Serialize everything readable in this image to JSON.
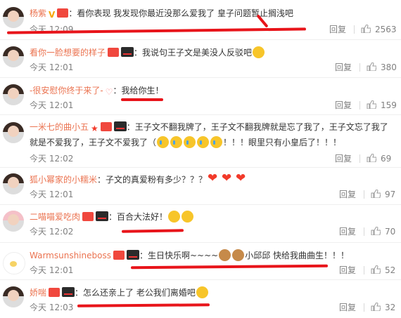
{
  "actions": {
    "reply": "回复"
  },
  "colors": {
    "name": "#eb7350",
    "meta": "#808080",
    "underline": "#e8141a"
  },
  "comments": [
    {
      "name": "杨紫",
      "text": "：看你表现 我发现你最近没那么爱我了 皇子问题暂止搁浅吧",
      "time": "今天 12:09",
      "likes": "2563"
    },
    {
      "name": "看你一脸想要的样子",
      "text": "：我说句王子文是美没人反驳吧",
      "time": "今天 12:01",
      "likes": "380"
    },
    {
      "name": "-很安慰你终于来了-",
      "text": "：我给你生！",
      "time": "今天 12:01",
      "likes": "159"
    },
    {
      "name": "一米七的曲小五",
      "text": "：王子文不翻我牌了，王子文不翻我牌就是忘了我了，王子文忘了我了",
      "text2": "就是不爱我了，王子文不爱我了（",
      "text3": "！！！眼里只有小皇后了！！！",
      "time": "今天 12:02",
      "likes": "69"
    },
    {
      "name": "狐小幂家的小糯米",
      "text": "：子文的真爱粉有多少？？？",
      "time": "今天 12:01",
      "likes": "97"
    },
    {
      "name": "二喵喵爱吃肉",
      "text": "：百合大法好！",
      "time": "今天 12:02",
      "likes": "70"
    },
    {
      "name": "Warmsunshineboss",
      "text": "：生日快乐啊~~~~",
      "text2": "小邱邱 快给我曲曲生！！！",
      "time": "今天 12:01",
      "likes": "52"
    },
    {
      "name": "娇喘",
      "text": "：怎么还亲上了 老公我们离婚吧",
      "time": "今天 12:03",
      "likes": "32"
    }
  ]
}
